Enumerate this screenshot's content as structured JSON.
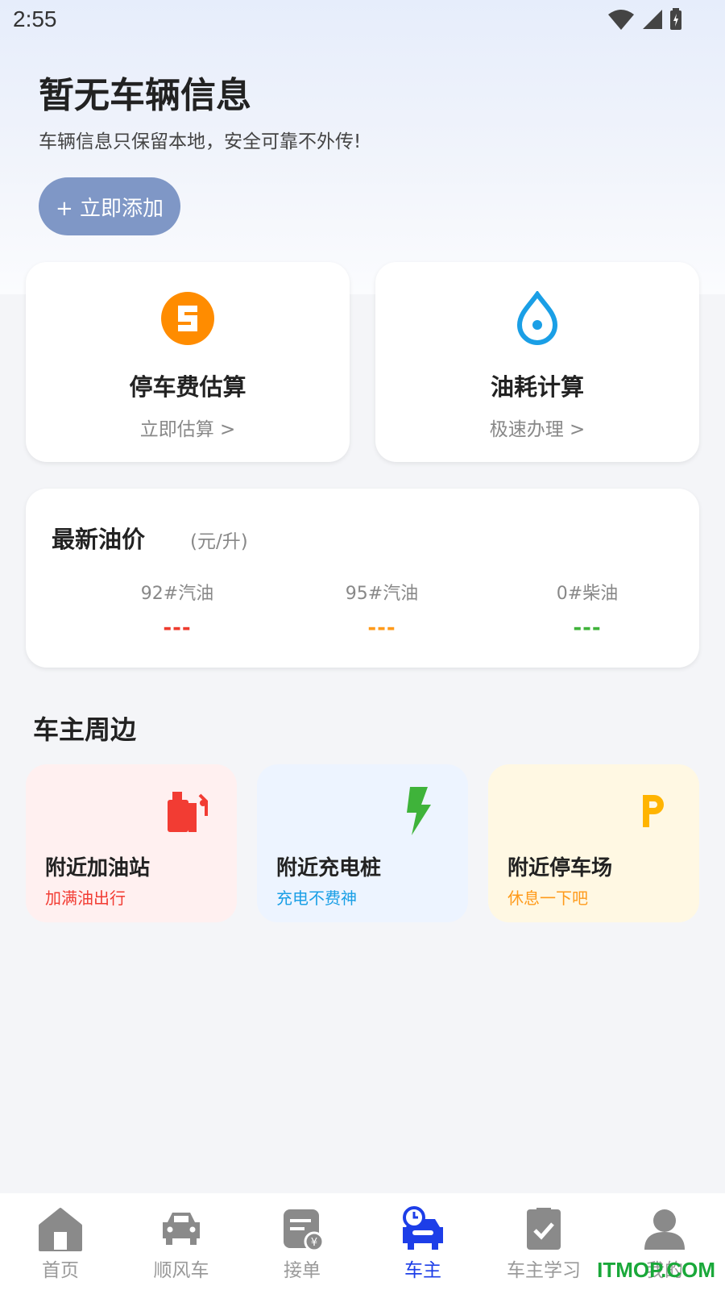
{
  "status": {
    "time": "2:55"
  },
  "vehicle": {
    "title": "暂无车辆信息",
    "subtitle": "车辆信息只保留本地，安全可靠不外传!",
    "add_label": "+ 立即添加"
  },
  "tools": [
    {
      "title": "停车费估算",
      "sub": "立即估算 >",
      "icon": "parking-fee-icon",
      "color": "#ff8c00"
    },
    {
      "title": "油耗计算",
      "sub": "极速办理 >",
      "icon": "fuel-drop-icon",
      "color": "#1a9fe6"
    }
  ],
  "oil_price": {
    "title": "最新油价",
    "unit": "(元/升)",
    "items": [
      {
        "name": "92#汽油",
        "value": "---",
        "color": "#ee3b2e"
      },
      {
        "name": "95#汽油",
        "value": "---",
        "color": "#ff9a1a"
      },
      {
        "name": "0#柴油",
        "value": "---",
        "color": "#3fb33a"
      }
    ]
  },
  "nearby": {
    "title": "车主周边",
    "items": [
      {
        "title": "附近加油站",
        "sub": "加满油出行",
        "icon": "gas-pump-icon",
        "bg": "#fff0f0",
        "color": "#f23c33"
      },
      {
        "title": "附近充电桩",
        "sub": "充电不费神",
        "icon": "lightning-icon",
        "bg": "#edf4ff",
        "color": "#1a9fe6"
      },
      {
        "title": "附近停车场",
        "sub": "休息一下吧",
        "icon": "parking-p-icon",
        "bg": "#fff8e3",
        "color": "#ff9a1a"
      }
    ]
  },
  "tabs": [
    {
      "label": "首页",
      "icon": "home-icon"
    },
    {
      "label": "顺风车",
      "icon": "car-icon"
    },
    {
      "label": "接单",
      "icon": "order-icon"
    },
    {
      "label": "车主",
      "icon": "car-owner-icon",
      "active": true
    },
    {
      "label": "车主学习",
      "icon": "study-icon"
    },
    {
      "label": "我的",
      "icon": "profile-icon"
    }
  ],
  "watermark": "ITMOP.COM"
}
